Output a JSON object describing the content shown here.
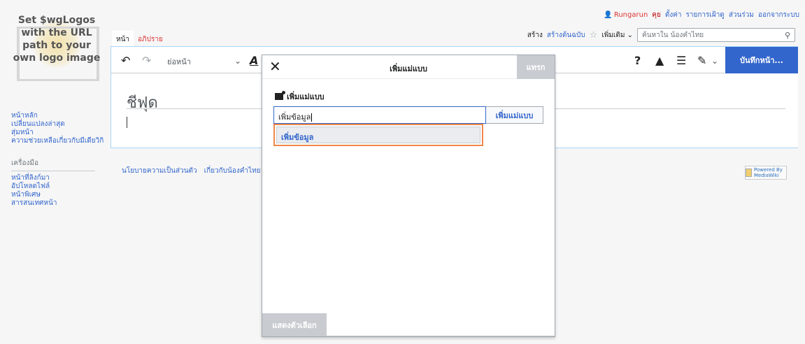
{
  "personal": {
    "user": "Rungarun",
    "talk": "คุย",
    "prefs": "ตั้งค่า",
    "watchlist": "รายการเฝ้าดู",
    "contribs": "ส่วนร่วม",
    "logout": "ออกจากระบบ"
  },
  "logo": {
    "text": "Set $wgLogos with the URL path to your own logo image"
  },
  "sidebar": {
    "nav": [
      "หน้าหลัก",
      "เปลี่ยนแปลงล่าสุด",
      "สุ่มหน้า",
      "ความช่วยเหลือเกี่ยวกับมีเดียวิกิ"
    ],
    "tools_heading": "เครื่องมือ",
    "tools": [
      "หน้าที่ลิงก์มา",
      "อัปโหลดไฟล์",
      "หน้าพิเศษ",
      "สารสนเทศหน้า"
    ]
  },
  "tabs": {
    "page": "หน้า",
    "talk": "อภิปราย",
    "create": "สร้าง",
    "create_source": "สร้างต้นฉบับ",
    "more": "เพิ่มเติม"
  },
  "search": {
    "placeholder": "ค้นหาใน น้องคำไทย"
  },
  "toolbar": {
    "paragraph": "ย่อหน้า",
    "save": "บันทึกหน้า..."
  },
  "page": {
    "title": "ชีฟุด"
  },
  "footer": {
    "privacy": "นโยบายความเป็นส่วนตัว",
    "about": "เกี่ยวกับน้องคำไทย",
    "powered": "Powered By MediaWiki"
  },
  "dialog": {
    "title": "เพิ่มแม่แบบ",
    "insert": "แทรก",
    "subtitle": "เพิ่มแม่แบบ",
    "input_value": "เพิ่มข้อมูล",
    "add_button": "เพิ่มแม่แบบ",
    "suggestion": "เพิ่มข้อมูล",
    "show_options": "แสดงตัวเลือก"
  }
}
